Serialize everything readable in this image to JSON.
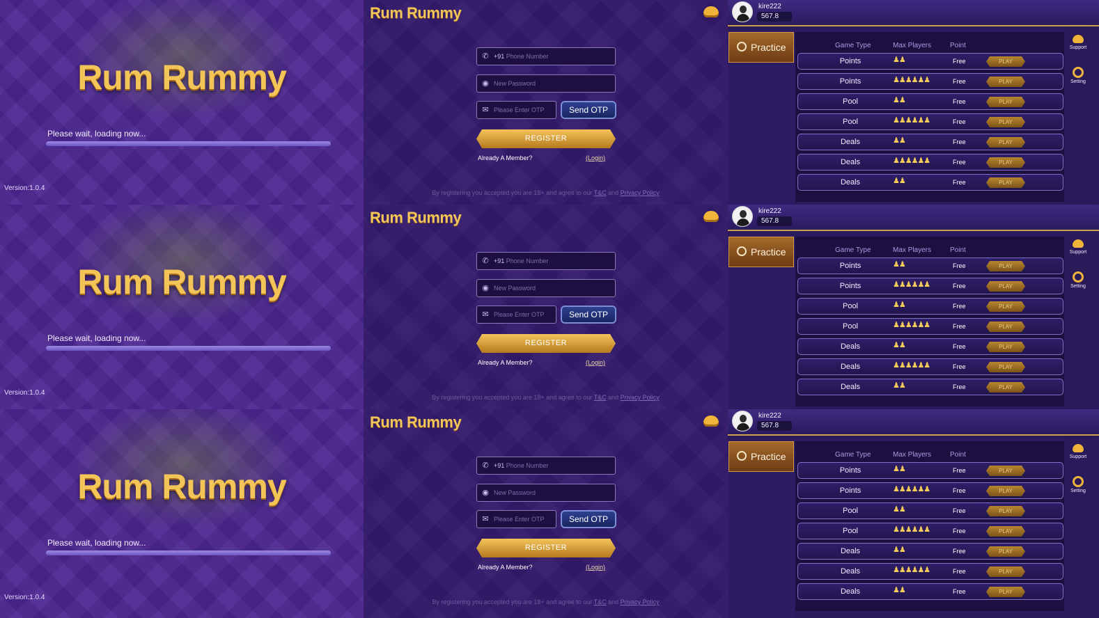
{
  "loading": {
    "brand": "Rum Rummy",
    "message": "Please wait, loading now...",
    "progress": 1.0,
    "version": "Version:1.0.4"
  },
  "register": {
    "brand": "Rum Rummy",
    "phone_code": "+91",
    "phone_placeholder": "Phone Number",
    "password_placeholder": "New Password",
    "otp_placeholder": "Please Enter OTP",
    "send_otp": "Send OTP",
    "register_btn": "REGISTER",
    "already_member": "Already A Member?",
    "login": "(Login)",
    "terms_prefix": "By registering you accepted you are 18+ and agree to our",
    "tc": "T&C",
    "and": "and",
    "privacy": "Privacy Policy"
  },
  "lobby": {
    "username": "kire222",
    "balance": "567.8",
    "practice": "Practice",
    "headers": {
      "game_type": "Game Type",
      "max_players": "Max Players",
      "point": "Point"
    },
    "support": "Support",
    "setting": "Setting",
    "play": "PLAY",
    "rows": [
      {
        "game": "Points",
        "players": 2,
        "price": "Free"
      },
      {
        "game": "Points",
        "players": 6,
        "price": "Free"
      },
      {
        "game": "Pool",
        "players": 2,
        "price": "Free"
      },
      {
        "game": "Pool",
        "players": 6,
        "price": "Free"
      },
      {
        "game": "Deals",
        "players": 2,
        "price": "Free"
      },
      {
        "game": "Deals",
        "players": 6,
        "price": "Free"
      },
      {
        "game": "Deals",
        "players": 2,
        "price": "Free"
      }
    ]
  },
  "colors": {
    "accent_gold": "#f3c558",
    "bg_purple": "#4b2590",
    "play_gold": "#b78630"
  },
  "icons": [
    "phone-icon",
    "lock-icon",
    "mail-icon",
    "support-icon",
    "gear-icon",
    "avatar",
    "chip-icon",
    "player-icon"
  ]
}
